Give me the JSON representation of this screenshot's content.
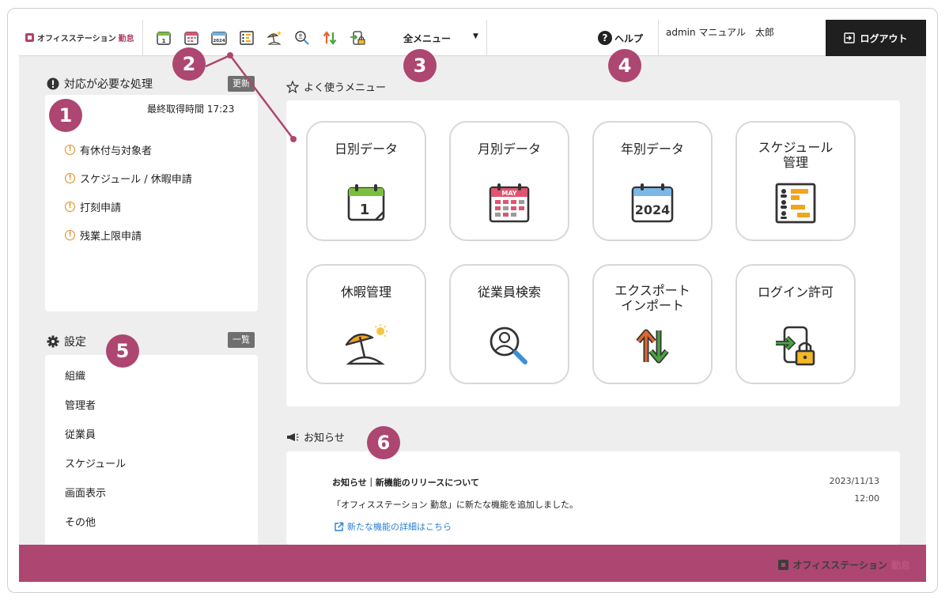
{
  "brand": {
    "name": "オフィスステーション",
    "product": "勤怠",
    "accent_color": "#ad4670"
  },
  "header": {
    "quick_icons": [
      {
        "name": "daily-data-icon"
      },
      {
        "name": "monthly-data-icon"
      },
      {
        "name": "yearly-data-icon"
      },
      {
        "name": "schedule-icon"
      },
      {
        "name": "vacation-icon"
      },
      {
        "name": "employee-search-icon"
      },
      {
        "name": "export-import-icon"
      },
      {
        "name": "login-permission-icon"
      }
    ],
    "all_menu_label": "全メニュー",
    "help_label": "ヘルプ",
    "user_text": "admin マニュアル　太郎",
    "logout_label": "ログアウト"
  },
  "pending": {
    "title": "対応が必要な処理",
    "refresh_label": "更新",
    "last_fetched": "最終取得時間 17:23",
    "items": [
      "有休付与対象者",
      "スケジュール / 休暇申請",
      "打刻申請",
      "残業上限申請"
    ]
  },
  "settings": {
    "title": "設定",
    "list_label": "一覧",
    "items": [
      "組織",
      "管理者",
      "従業員",
      "スケジュール",
      "画面表示",
      "その他"
    ]
  },
  "favorites": {
    "title": "よく使うメニュー",
    "tiles": [
      {
        "label": "日別データ",
        "icon": "daily-calendar-icon"
      },
      {
        "label": "月別データ",
        "icon": "monthly-calendar-icon",
        "icon_text": "MAY"
      },
      {
        "label": "年別データ",
        "icon": "yearly-calendar-icon",
        "icon_text": "2024"
      },
      {
        "label": "スケジュール\n管理",
        "icon": "schedule-chart-icon"
      },
      {
        "label": "休暇管理",
        "icon": "beach-umbrella-icon"
      },
      {
        "label": "従業員検索",
        "icon": "person-search-icon"
      },
      {
        "label": "エクスポート\nインポート",
        "icon": "up-down-arrows-icon"
      },
      {
        "label": "ログイン許可",
        "icon": "login-lock-icon"
      }
    ]
  },
  "notice": {
    "title": "お知らせ",
    "item_title": "お知らせ｜新機能のリリースについて",
    "item_body": "「オフィスステーション 勤怠」に新たな機能を追加しました。",
    "item_link": "新たな機能の詳細はこちら",
    "date": "2023/11/13",
    "time": "12:00"
  },
  "annotations": [
    "1",
    "2",
    "3",
    "4",
    "5",
    "6"
  ]
}
